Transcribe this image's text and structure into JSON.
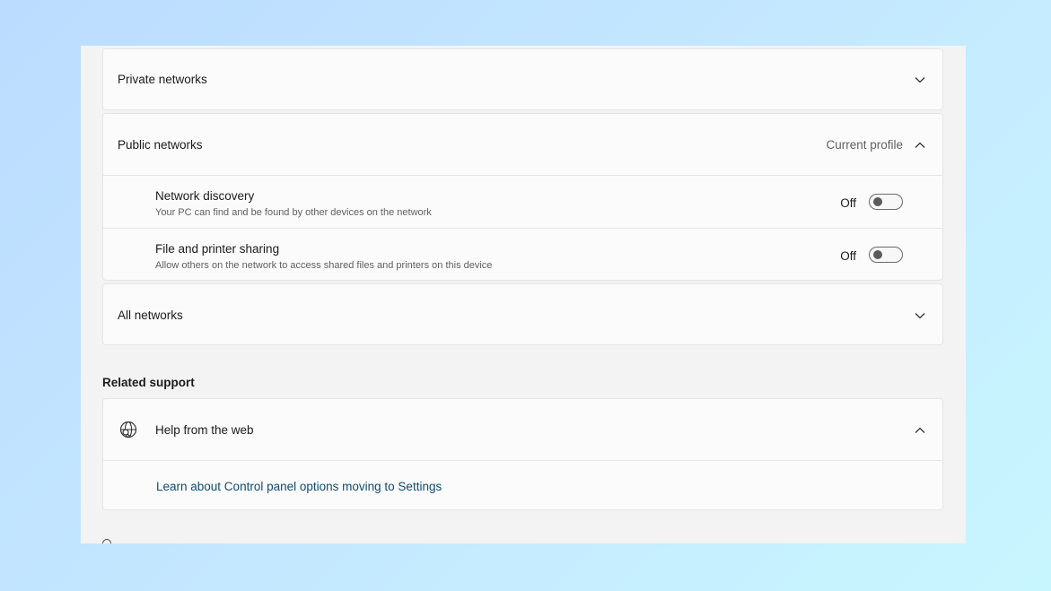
{
  "profiles": {
    "private": {
      "label": "Private networks"
    },
    "public": {
      "label": "Public networks",
      "badge": "Current profile",
      "settings": [
        {
          "title": "Network discovery",
          "description": "Your PC can find and be found by other devices on the network",
          "state": "Off"
        },
        {
          "title": "File and printer sharing",
          "description": "Allow others on the network to access shared files and printers on this device",
          "state": "Off"
        }
      ]
    },
    "all": {
      "label": "All networks"
    }
  },
  "related_support": {
    "heading": "Related support",
    "help": {
      "label": "Help from the web",
      "icon": "globe-search-icon",
      "links": [
        "Learn about Control panel options moving to Settings"
      ]
    }
  },
  "colors": {
    "background_start": "#bcdcff",
    "background_end": "#c8f6ff",
    "panel": "#f3f3f3",
    "card": "#fbfbfb",
    "link": "#0f4a6e"
  }
}
